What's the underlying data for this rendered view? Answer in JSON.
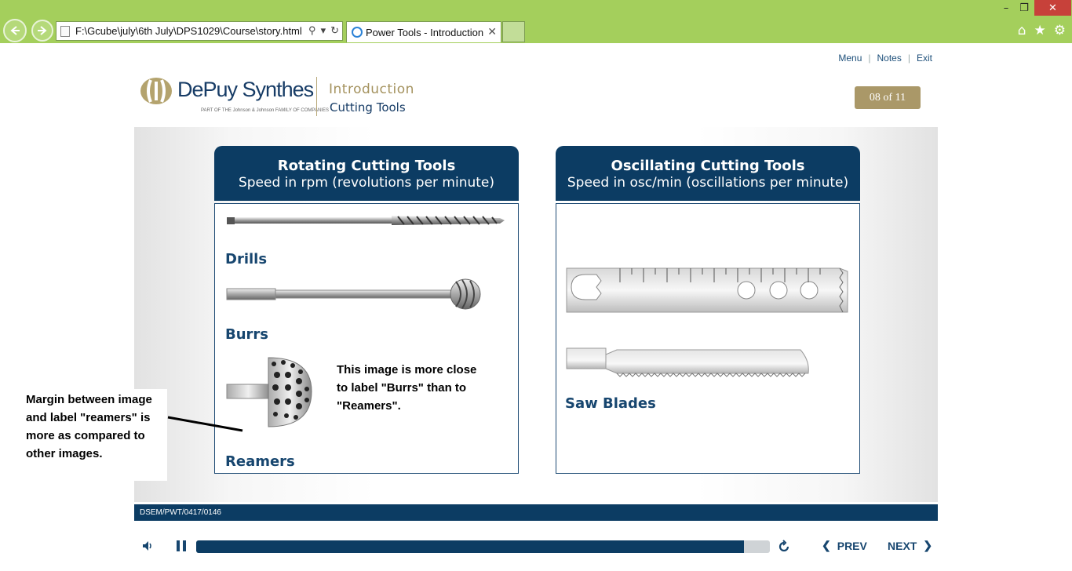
{
  "browser": {
    "address": "F:\\Gcube\\july\\6th July\\DPS1029\\Course\\story.html",
    "tab_title": "Power Tools - Introduction",
    "icons": [
      "back-icon",
      "forward-icon",
      "search-icon",
      "refresh-icon",
      "close-icon",
      "home-icon",
      "star-icon",
      "gear-icon",
      "minimize-icon",
      "restore-icon"
    ]
  },
  "player": {
    "top_links": {
      "menu": "Menu",
      "notes": "Notes",
      "exit": "Exit"
    },
    "logo": {
      "name": "DePuy Synthes",
      "tagline": "PART OF THE Johnson & Johnson FAMILY OF COMPANIES"
    },
    "section_title": "Introduction",
    "section_subtitle": "Cutting Tools",
    "page_counter": "08 of 11",
    "footer_code": "DSEM/PWT/0417/0146",
    "progress_percent": 95.5,
    "prev_label": "PREV",
    "next_label": "NEXT"
  },
  "rotating": {
    "title": "Rotating Cutting Tools",
    "subtitle": "Speed in rpm (revolutions per minute)",
    "labels": {
      "drills": "Drills",
      "burrs": "Burrs",
      "reamers": "Reamers"
    }
  },
  "oscillating": {
    "title": "Oscillating Cutting Tools",
    "subtitle": "Speed in osc/min (oscillations per minute)",
    "labels": {
      "saw_blades": "Saw Blades"
    }
  },
  "annotations": {
    "left_note": "Margin between image and label \"reamers\" is more as compared to  other images.",
    "image_note": "This image is more close to label \"Burrs\" than to \"Reamers\"."
  },
  "colors": {
    "navy": "#0c3c63",
    "gold": "#aa9868",
    "chrome_green": "#a4cf5c"
  }
}
